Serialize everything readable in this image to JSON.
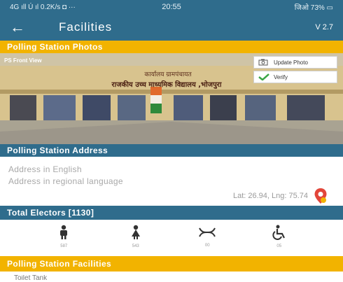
{
  "status_bar": {
    "left": "4G ıll Ú ıl 0.2K/s ◘ ···",
    "time": "20:55",
    "right": "जिओ 73% ▭"
  },
  "app_bar": {
    "back_icon": "arrow-left-icon",
    "title": "Facilities",
    "version": "V 2.7"
  },
  "photos_section": {
    "header": "Polling Station Photos",
    "caption": "PS Front View",
    "sign_line1": "कार्यालय ग्रामपंचायत",
    "sign_line2": "राजकीय उच्च माध्यमिक विद्यालय ,भोजपुरा",
    "update_photo": "Update Photo",
    "verify": "Verify"
  },
  "address_section": {
    "header": "Polling Station Address",
    "english": "Address in English",
    "regional": "Address in regional language",
    "latlng": "Lat: 26.94, Lng: 75.74"
  },
  "electors_section": {
    "header": "Total Electors [1130]",
    "items": [
      {
        "icon": "male-icon",
        "count": "587"
      },
      {
        "icon": "female-icon",
        "count": "543"
      },
      {
        "icon": "third-gender-icon",
        "count": "00"
      },
      {
        "icon": "wheelchair-icon",
        "count": "05"
      }
    ]
  },
  "facilities_section": {
    "header": "Polling Station Facilities",
    "first_item": "Toilet Tank"
  },
  "colors": {
    "primary": "#2f6c8c",
    "accent": "#f2b300",
    "verify_check": "#3aa645",
    "pin": "#e2463a"
  }
}
